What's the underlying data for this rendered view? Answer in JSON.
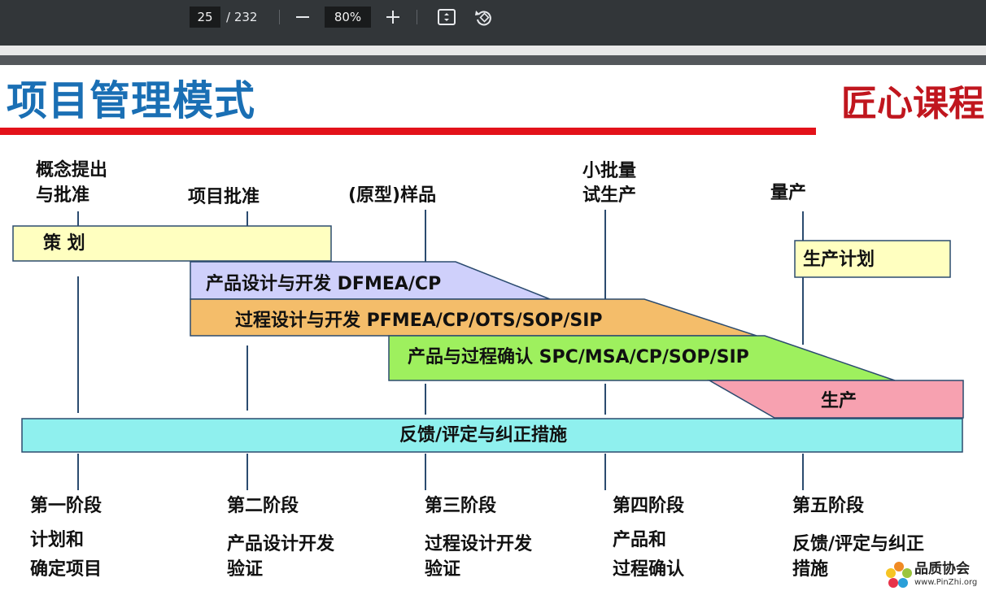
{
  "toolbar": {
    "page_current": "25",
    "page_total": "/ 232",
    "zoom": "80%",
    "icons": [
      "zoom-out-icon",
      "zoom-in-icon",
      "fit-page-icon",
      "rotate-icon"
    ]
  },
  "slide": {
    "title": "项目管理模式",
    "brand": "匠心课程",
    "milestones": [
      {
        "line1": "概念提出",
        "line2": "与批准"
      },
      {
        "line1": "项目批准",
        "line2": ""
      },
      {
        "line1": "(原型)样品",
        "line2": ""
      },
      {
        "line1": "小批量",
        "line2": "试生产"
      },
      {
        "line1": "量产",
        "line2": ""
      }
    ],
    "bands": {
      "planning": "策         划",
      "product_design": "产品设计与开发 DFMEA/CP",
      "process_design": "过程设计与开发 PFMEA/CP/OTS/SOP/SIP",
      "validation": "产品与过程确认 SPC/MSA/CP/SOP/SIP",
      "production": "生产",
      "production_plan": "生产计划",
      "feedback": "反馈/评定与纠正措施"
    },
    "phases": [
      {
        "name": "第一阶段",
        "desc1": "计划和",
        "desc2": "确定项目"
      },
      {
        "name": "第二阶段",
        "desc1": "产品设计开发",
        "desc2": "验证"
      },
      {
        "name": "第三阶段",
        "desc1": "过程设计开发",
        "desc2": "验证"
      },
      {
        "name": "第四阶段",
        "desc1": "产品和",
        "desc2": "过程确认"
      },
      {
        "name": "第五阶段",
        "desc1": "反馈/评定与纠正",
        "desc2": "措施"
      }
    ],
    "colors": {
      "title": "#1a6fb4",
      "brand": "#c0161e",
      "planning": "#ffffc0",
      "product_design": "#cfd0fb",
      "process_design": "#f4bd6a",
      "validation": "#9ef05e",
      "production": "#f7a1b0",
      "feedback": "#8ff0ee"
    }
  },
  "watermark": {
    "name": "品质协会",
    "url": "www.PinZhi.org"
  }
}
